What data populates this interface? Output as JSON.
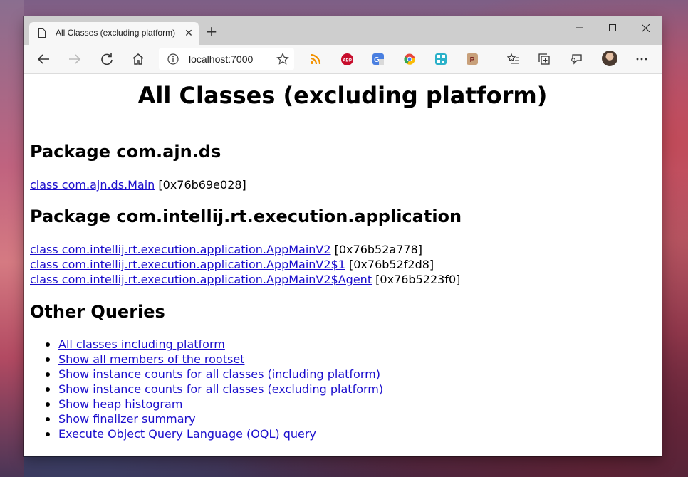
{
  "browser": {
    "tab_title": "All Classes (excluding platform)",
    "tab_close": "✕",
    "new_tab": "+",
    "address": "localhost:7000"
  },
  "page": {
    "title": "All Classes (excluding platform)",
    "packages": [
      {
        "heading": "Package com.ajn.ds",
        "classes": [
          {
            "link": "class com.ajn.ds.Main",
            "addr": " [0x76b69e028]"
          }
        ]
      },
      {
        "heading": "Package com.intellij.rt.execution.application",
        "classes": [
          {
            "link": "class com.intellij.rt.execution.application.AppMainV2",
            "addr": " [0x76b52a778]"
          },
          {
            "link": "class com.intellij.rt.execution.application.AppMainV2$1",
            "addr": " [0x76b52f2d8]"
          },
          {
            "link": "class com.intellij.rt.execution.application.AppMainV2$Agent",
            "addr": " [0x76b5223f0]"
          }
        ]
      }
    ],
    "other_heading": "Other Queries",
    "queries": [
      "All classes including platform",
      "Show all members of the rootset",
      "Show instance counts for all classes (including platform)",
      "Show instance counts for all classes (excluding platform)",
      "Show heap histogram",
      "Show finalizer summary",
      "Execute Object Query Language (OQL) query"
    ]
  },
  "colors": {
    "link": "#1a0dcc",
    "titlebar": "#cecece",
    "toolbar": "#f7f7f7"
  }
}
